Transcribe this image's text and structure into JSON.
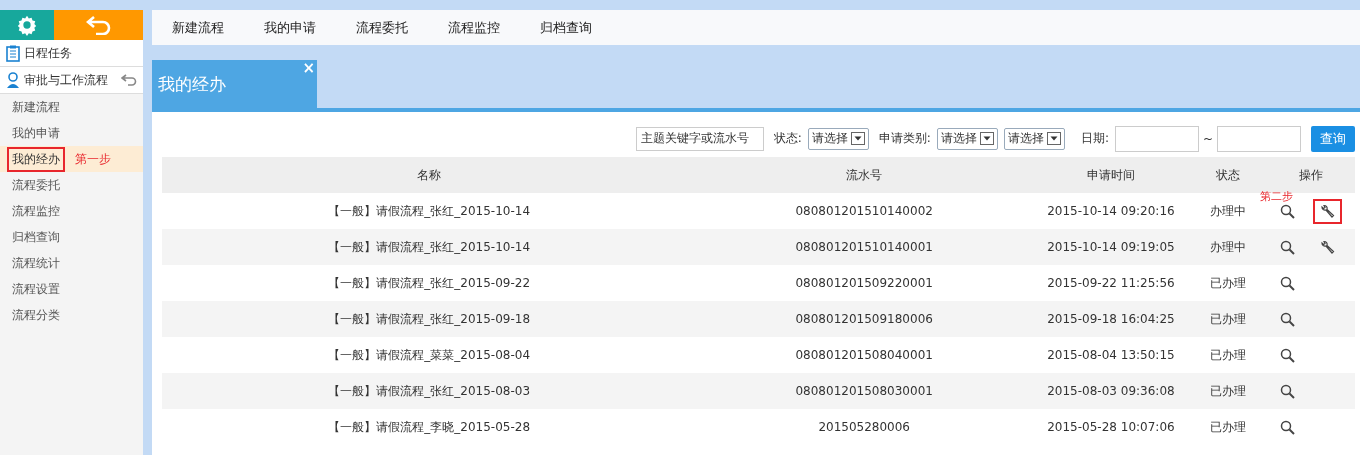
{
  "sidebar": {
    "items": [
      {
        "label": "日程任务",
        "kind": "calendar"
      },
      {
        "label": "审批与工作流程",
        "kind": "workflow"
      }
    ],
    "submenu": [
      {
        "label": "新建流程",
        "selected": false
      },
      {
        "label": "我的申请",
        "selected": false
      },
      {
        "label": "我的经办",
        "selected": true,
        "annotation": "第一步"
      },
      {
        "label": "流程委托",
        "selected": false
      },
      {
        "label": "流程监控",
        "selected": false
      },
      {
        "label": "归档查询",
        "selected": false
      },
      {
        "label": "流程统计",
        "selected": false
      },
      {
        "label": "流程设置",
        "selected": false
      },
      {
        "label": "流程分类",
        "selected": false
      }
    ]
  },
  "top_nav": [
    "新建流程",
    "我的申请",
    "流程委托",
    "流程监控",
    "归档查询"
  ],
  "tab": {
    "label": "我的经办",
    "close": "×"
  },
  "filters": {
    "keyword": {
      "value": "主题关键字或流水号"
    },
    "status_label": "状态:",
    "status_select": "请选择",
    "type_label": "申请类别:",
    "type_selects": [
      "请选择",
      "请选择"
    ],
    "date_label": "日期:",
    "date_separator": "~",
    "query_button": "查询"
  },
  "table": {
    "columns": [
      "名称",
      "流水号",
      "申请时间",
      "状态",
      "操作"
    ],
    "rows": [
      {
        "name": "【一般】请假流程_张红_2015-10-14",
        "serial": "080801201510140002",
        "time": "2015-10-14 09:20:16",
        "status": "办理中",
        "editable": true,
        "highlighted": true,
        "annotation": "第二步"
      },
      {
        "name": "【一般】请假流程_张红_2015-10-14",
        "serial": "080801201510140001",
        "time": "2015-10-14 09:19:05",
        "status": "办理中",
        "editable": true,
        "highlighted": false
      },
      {
        "name": "【一般】请假流程_张红_2015-09-22",
        "serial": "080801201509220001",
        "time": "2015-09-22 11:25:56",
        "status": "已办理",
        "editable": false
      },
      {
        "name": "【一般】请假流程_张红_2015-09-18",
        "serial": "080801201509180006",
        "time": "2015-09-18 16:04:25",
        "status": "已办理",
        "editable": false
      },
      {
        "name": "【一般】请假流程_菜菜_2015-08-04",
        "serial": "080801201508040001",
        "time": "2015-08-04 13:50:15",
        "status": "已办理",
        "editable": false
      },
      {
        "name": "【一般】请假流程_张红_2015-08-03",
        "serial": "080801201508030001",
        "time": "2015-08-03 09:36:08",
        "status": "已办理",
        "editable": false
      },
      {
        "name": "【一般】请假流程_李晓_2015-05-28",
        "serial": "201505280006",
        "time": "2015-05-28 10:07:06",
        "status": "已办理",
        "editable": false
      }
    ]
  }
}
